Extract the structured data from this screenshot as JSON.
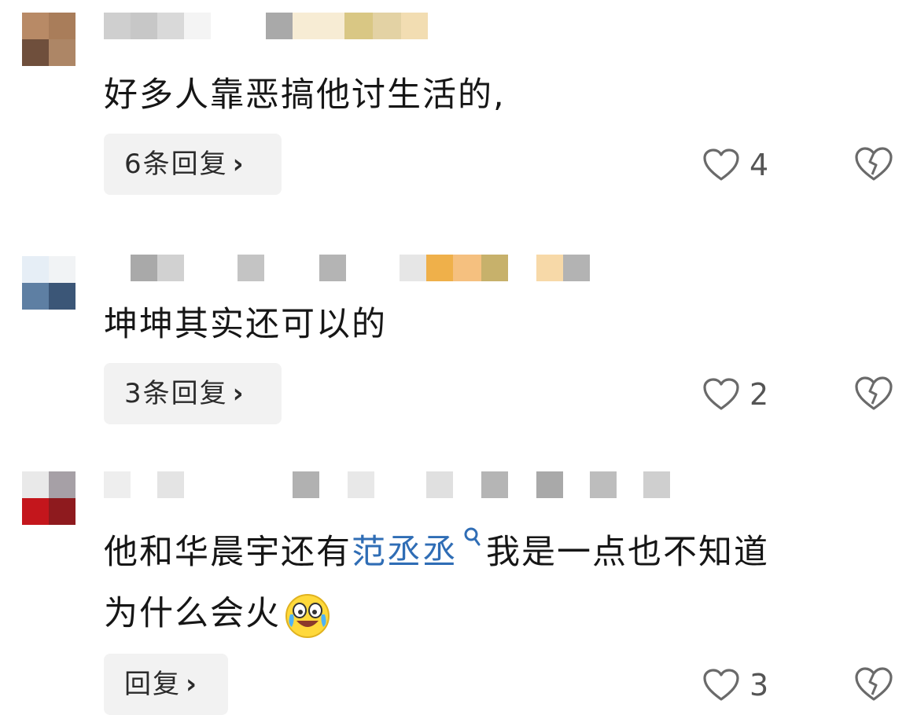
{
  "comments": [
    {
      "text": "好多人靠恶搞他讨生活的,",
      "reply_label": "6条回复",
      "chevron": "›",
      "likes": "4",
      "avatar_colors": [
        "#b88a66",
        "#a97d5a",
        "#6f4f3c",
        "#ad8666"
      ],
      "name_colors": [
        "#cfcfcf",
        "#c7c7c7",
        "#d9d9d9",
        "#f4f4f4",
        "#a9a9a9",
        "#f7ecd4",
        "#d9c784",
        "#e3d2a4",
        "#f2ddb2"
      ]
    },
    {
      "text": "坤坤其实还可以的",
      "reply_label": "3条回复",
      "chevron": "›",
      "likes": "2",
      "avatar_colors": [
        "#e6eef6",
        "#f1f3f5",
        "#5e7fa3",
        "#3b5677"
      ],
      "name_colors": [
        "#a9a9a9",
        "#d1d1d1",
        "#c4c4c4",
        "#b4b4b4",
        "#e6e6e6",
        "#efb04a",
        "#f5c07f",
        "#c7b16b",
        "#f7d9a8",
        "#b3b3b3"
      ]
    },
    {
      "text_before": "他和华晨宇还有",
      "link_text": "范丞丞",
      "text_after": "我是一点也不知道",
      "text_line2": "为什么会火",
      "reply_label": "回复",
      "chevron": "›",
      "likes": "3",
      "avatar_colors": [
        "#e9e9e9",
        "#a6a0a6",
        "#c4161c",
        "#8e1a1e"
      ],
      "name_colors": [
        "#eeeeee",
        "#e4e4e4",
        "#b1b1b1",
        "#e8e8e8",
        "#e0e0e0",
        "#b5b5b5",
        "#a9a9a9",
        "#bdbdbd",
        "#cfcfcf"
      ]
    }
  ],
  "icons": {
    "like": "heart-outline-icon",
    "dislike": "broken-heart-icon",
    "search": "search-icon",
    "emoji": "crying-laughing-emoji-icon"
  },
  "colors": {
    "link": "#2f6db5",
    "reply_bg": "#f2f2f2",
    "icon": "#6a6a6a"
  }
}
